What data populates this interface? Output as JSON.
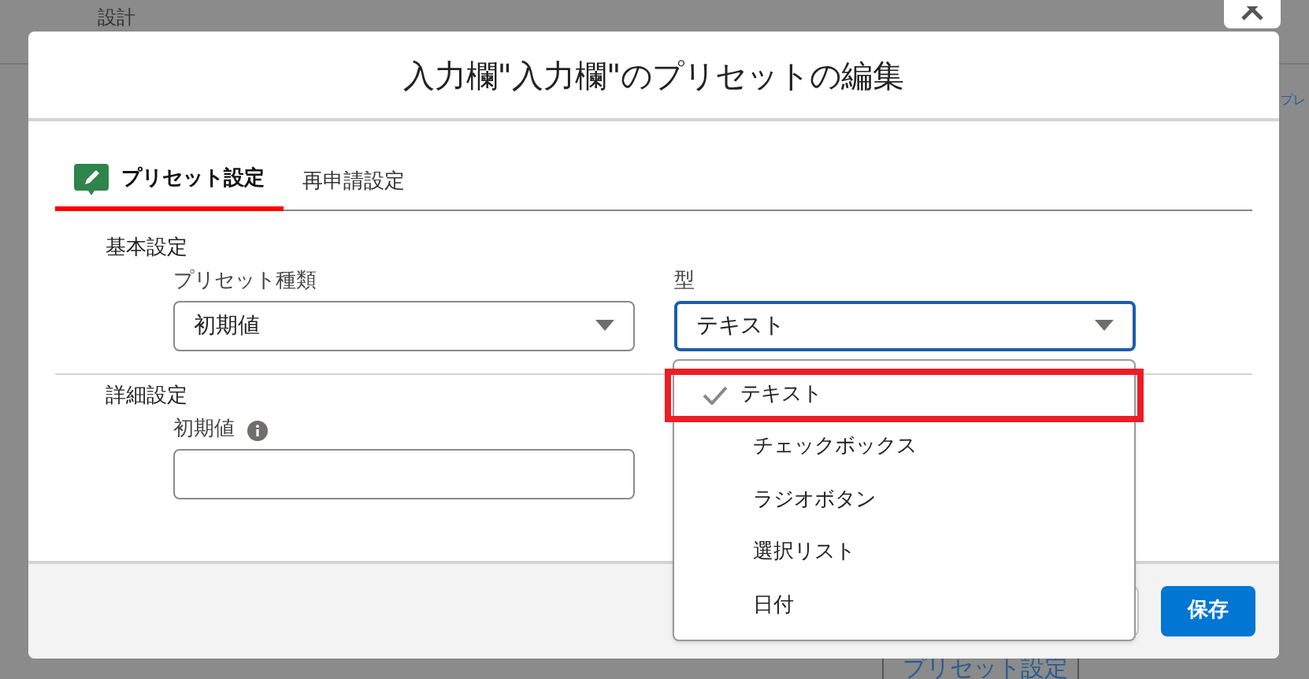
{
  "background": {
    "heading": "設計",
    "side_link": "プレ",
    "bottom_cell": "プリセット設定"
  },
  "dialog": {
    "title": "入力欄\"入力欄\"のプリセットの編集",
    "tabs": [
      {
        "label": "プリセット設定",
        "selected": true
      },
      {
        "label": "再申請設定",
        "selected": false
      }
    ],
    "sections": [
      {
        "title": "基本設定",
        "fields": [
          {
            "kind": "select",
            "label": "プリセット種類",
            "value": "初期値",
            "focused": false
          },
          {
            "kind": "select",
            "label": "型",
            "value": "テキスト",
            "focused": true
          }
        ]
      },
      {
        "title": "詳細設定",
        "fields": [
          {
            "kind": "text",
            "label": "初期値",
            "info": true,
            "focused": false
          }
        ]
      }
    ],
    "save_button": "保存"
  },
  "dropdown": {
    "options": [
      {
        "label": "テキスト",
        "selected": true,
        "highlighted": true
      },
      {
        "label": "チェックボックス",
        "selected": false,
        "highlighted": false
      },
      {
        "label": "ラジオボタン",
        "selected": false,
        "highlighted": false
      },
      {
        "label": "選択リスト",
        "selected": false,
        "highlighted": false
      },
      {
        "label": "日付",
        "selected": false,
        "highlighted": false
      }
    ]
  }
}
